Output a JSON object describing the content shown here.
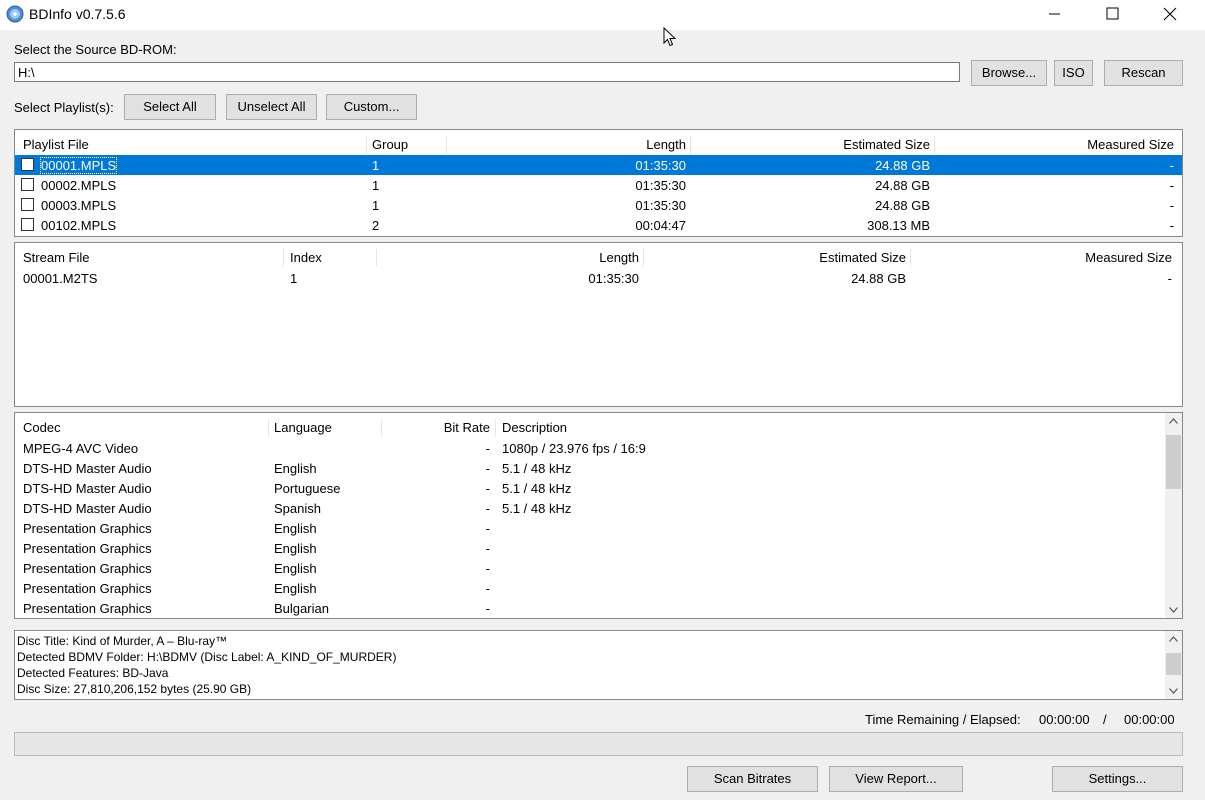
{
  "window": {
    "title": "BDInfo v0.7.5.6"
  },
  "source": {
    "label": "Select the Source BD-ROM:",
    "path": "H:\\",
    "browse_label": "Browse...",
    "iso_label": "ISO",
    "rescan_label": "Rescan"
  },
  "playlist_select": {
    "label": "Select Playlist(s):",
    "select_all_label": "Select All",
    "unselect_all_label": "Unselect All",
    "custom_label": "Custom..."
  },
  "playlists": {
    "headers": [
      "Playlist File",
      "Group",
      "Length",
      "Estimated Size",
      "Measured Size"
    ],
    "rows": [
      {
        "file": "00001.MPLS",
        "group": "1",
        "length": "01:35:30",
        "est": "24.88 GB",
        "meas": "-",
        "checked": false,
        "selected": true
      },
      {
        "file": "00002.MPLS",
        "group": "1",
        "length": "01:35:30",
        "est": "24.88 GB",
        "meas": "-",
        "checked": false,
        "selected": false
      },
      {
        "file": "00003.MPLS",
        "group": "1",
        "length": "01:35:30",
        "est": "24.88 GB",
        "meas": "-",
        "checked": false,
        "selected": false
      },
      {
        "file": "00102.MPLS",
        "group": "2",
        "length": "00:04:47",
        "est": "308.13 MB",
        "meas": "-",
        "checked": false,
        "selected": false
      }
    ]
  },
  "streams": {
    "headers": [
      "Stream File",
      "Index",
      "Length",
      "Estimated Size",
      "Measured Size"
    ],
    "rows": [
      {
        "file": "00001.M2TS",
        "index": "1",
        "length": "01:35:30",
        "est": "24.88 GB",
        "meas": "-"
      }
    ]
  },
  "codecs": {
    "headers": [
      "Codec",
      "Language",
      "Bit Rate",
      "Description"
    ],
    "rows": [
      {
        "codec": "MPEG-4 AVC Video",
        "lang": "",
        "bitrate": "-",
        "desc": "1080p / 23.976 fps / 16:9"
      },
      {
        "codec": "DTS-HD Master Audio",
        "lang": "English",
        "bitrate": "-",
        "desc": "5.1 / 48 kHz"
      },
      {
        "codec": "DTS-HD Master Audio",
        "lang": "Portuguese",
        "bitrate": "-",
        "desc": "5.1 / 48 kHz"
      },
      {
        "codec": "DTS-HD Master Audio",
        "lang": "Spanish",
        "bitrate": "-",
        "desc": "5.1 / 48 kHz"
      },
      {
        "codec": "Presentation Graphics",
        "lang": "English",
        "bitrate": "-",
        "desc": ""
      },
      {
        "codec": "Presentation Graphics",
        "lang": "English",
        "bitrate": "-",
        "desc": ""
      },
      {
        "codec": "Presentation Graphics",
        "lang": "English",
        "bitrate": "-",
        "desc": ""
      },
      {
        "codec": "Presentation Graphics",
        "lang": "English",
        "bitrate": "-",
        "desc": ""
      },
      {
        "codec": "Presentation Graphics",
        "lang": "Bulgarian",
        "bitrate": "-",
        "desc": ""
      }
    ]
  },
  "disc_info": [
    "Disc Title: Kind of Murder, A – Blu-ray™",
    "Detected BDMV Folder: H:\\BDMV (Disc Label: A_KIND_OF_MURDER)",
    "Detected Features: BD-Java",
    "Disc Size: 27,810,206,152 bytes (25.90 GB)"
  ],
  "status": {
    "time_label": "Time Remaining / Elapsed:",
    "remaining": "00:00:00",
    "slash": "/",
    "elapsed": "00:00:00",
    "progress": 0
  },
  "actions": {
    "scan_label": "Scan Bitrates",
    "report_label": "View Report...",
    "settings_label": "Settings..."
  },
  "colors": {
    "selection": "#0078d7",
    "window_bg": "#f0f0f0",
    "button_bg": "#e1e1e1"
  }
}
